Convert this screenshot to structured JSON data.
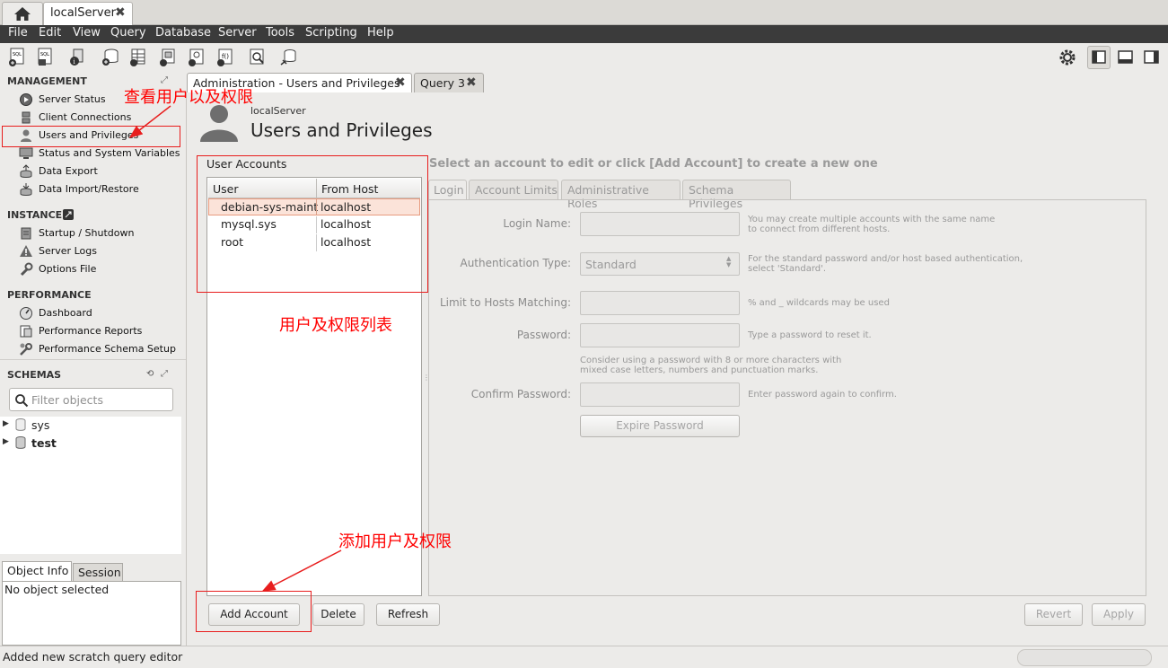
{
  "connection_tab": {
    "label": "localServer"
  },
  "menu": [
    "File",
    "Edit",
    "View",
    "Query",
    "Database",
    "Server",
    "Tools",
    "Scripting",
    "Help"
  ],
  "sidebar": {
    "management": {
      "title": "MANAGEMENT",
      "items": [
        {
          "label": "Server Status",
          "icon": "play-circle-icon"
        },
        {
          "label": "Client Connections",
          "icon": "connections-icon"
        },
        {
          "label": "Users and Privileges",
          "icon": "user-icon"
        },
        {
          "label": "Status and System Variables",
          "icon": "monitor-icon"
        },
        {
          "label": "Data Export",
          "icon": "export-icon"
        },
        {
          "label": "Data Import/Restore",
          "icon": "import-icon"
        }
      ]
    },
    "instance": {
      "title": "INSTANCE",
      "items": [
        {
          "label": "Startup / Shutdown",
          "icon": "startup-icon"
        },
        {
          "label": "Server Logs",
          "icon": "warning-icon"
        },
        {
          "label": "Options File",
          "icon": "wrench-icon"
        }
      ]
    },
    "performance": {
      "title": "PERFORMANCE",
      "items": [
        {
          "label": "Dashboard",
          "icon": "dashboard-icon"
        },
        {
          "label": "Performance Reports",
          "icon": "reports-icon"
        },
        {
          "label": "Performance Schema Setup",
          "icon": "schema-setup-icon"
        }
      ]
    },
    "schemas": {
      "title": "SCHEMAS",
      "filter_placeholder": "Filter objects",
      "items": [
        {
          "label": "sys",
          "bold": false
        },
        {
          "label": "test",
          "bold": true
        }
      ]
    },
    "bottom_tabs": [
      "Object Info",
      "Session"
    ],
    "object_info_text": "No object selected"
  },
  "main_tabs": [
    {
      "label": "Administration - Users and Privileges",
      "active": true
    },
    {
      "label": "Query 3",
      "active": false
    }
  ],
  "header": {
    "server": "localServer",
    "title": "Users and Privileges"
  },
  "accounts": {
    "group_label": "User Accounts",
    "columns": [
      "User",
      "From Host"
    ],
    "rows": [
      {
        "user": "debian-sys-maint",
        "host": "localhost",
        "selected": true
      },
      {
        "user": "mysql.sys",
        "host": "localhost",
        "selected": false
      },
      {
        "user": "root",
        "host": "localhost",
        "selected": false
      }
    ]
  },
  "detail": {
    "prompt": "Select an account to edit or click [Add Account] to create a new one",
    "tabs": [
      "Login",
      "Account Limits",
      "Administrative Roles",
      "Schema Privileges"
    ],
    "fields": {
      "login_name": {
        "label": "Login Name:",
        "hint": [
          "You may create multiple accounts with the same name",
          "to connect from different hosts."
        ]
      },
      "auth_type": {
        "label": "Authentication Type:",
        "value": "Standard",
        "hint": [
          "For the standard password and/or host based authentication,",
          "select 'Standard'."
        ]
      },
      "hosts": {
        "label": "Limit to Hosts Matching:",
        "hint": [
          "% and _ wildcards may be used"
        ]
      },
      "password": {
        "label": "Password:",
        "hint": [
          "Type a password to reset it."
        ]
      },
      "password_note": [
        "Consider using a password with 8 or more characters with",
        "mixed case letters, numbers and punctuation marks."
      ],
      "confirm": {
        "label": "Confirm Password:",
        "hint": [
          "Enter password again to confirm."
        ]
      }
    },
    "expire_button": "Expire Password"
  },
  "buttons": {
    "add": "Add Account",
    "delete": "Delete",
    "refresh": "Refresh",
    "revert": "Revert",
    "apply": "Apply"
  },
  "statusbar": "Added new scratch query editor",
  "annotations": {
    "view_users": "查看用户以及权限",
    "list": "用户及权限列表",
    "add": "添加用户及权限"
  }
}
